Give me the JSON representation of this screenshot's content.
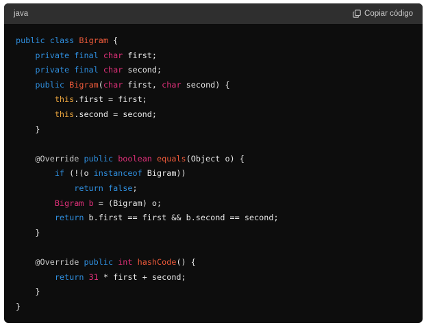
{
  "header": {
    "language": "java",
    "copy_label": "Copiar código",
    "copy_icon": "copy-icon"
  },
  "colors": {
    "background": "#0d0d0d",
    "header_background": "#2f2f2f",
    "keyword": "#2f8fdf",
    "type": "#df3079",
    "name": "#ee5a3a",
    "this": "#e8a33d",
    "plain": "#e8e8e8"
  },
  "code": {
    "lines": [
      [
        [
          "kw",
          "public"
        ],
        [
          "pl",
          " "
        ],
        [
          "kw",
          "class"
        ],
        [
          "pl",
          " "
        ],
        [
          "nm",
          "Bigram"
        ],
        [
          "pl",
          " {"
        ]
      ],
      [
        [
          "pl",
          "    "
        ],
        [
          "kw",
          "private"
        ],
        [
          "pl",
          " "
        ],
        [
          "kw",
          "final"
        ],
        [
          "pl",
          " "
        ],
        [
          "ty",
          "char"
        ],
        [
          "pl",
          " first;"
        ]
      ],
      [
        [
          "pl",
          "    "
        ],
        [
          "kw",
          "private"
        ],
        [
          "pl",
          " "
        ],
        [
          "kw",
          "final"
        ],
        [
          "pl",
          " "
        ],
        [
          "ty",
          "char"
        ],
        [
          "pl",
          " second;"
        ]
      ],
      [
        [
          "pl",
          "    "
        ],
        [
          "kw",
          "public"
        ],
        [
          "pl",
          " "
        ],
        [
          "nm",
          "Bigram"
        ],
        [
          "pl",
          "("
        ],
        [
          "ty",
          "char"
        ],
        [
          "pl",
          " first, "
        ],
        [
          "ty",
          "char"
        ],
        [
          "pl",
          " second) {"
        ]
      ],
      [
        [
          "pl",
          "        "
        ],
        [
          "th",
          "this"
        ],
        [
          "pl",
          ".first = first;"
        ]
      ],
      [
        [
          "pl",
          "        "
        ],
        [
          "th",
          "this"
        ],
        [
          "pl",
          ".second = second;"
        ]
      ],
      [
        [
          "pl",
          "    }"
        ]
      ],
      [
        [
          "pl",
          ""
        ]
      ],
      [
        [
          "pl",
          "    "
        ],
        [
          "an",
          "@Override"
        ],
        [
          "pl",
          " "
        ],
        [
          "kw",
          "public"
        ],
        [
          "pl",
          " "
        ],
        [
          "ty",
          "boolean"
        ],
        [
          "pl",
          " "
        ],
        [
          "nm",
          "equals"
        ],
        [
          "pl",
          "(Object o) {"
        ]
      ],
      [
        [
          "pl",
          "        "
        ],
        [
          "kw",
          "if"
        ],
        [
          "pl",
          " (!(o "
        ],
        [
          "kw",
          "instanceof"
        ],
        [
          "pl",
          " Bigram))"
        ]
      ],
      [
        [
          "pl",
          "            "
        ],
        [
          "kw",
          "return"
        ],
        [
          "pl",
          " "
        ],
        [
          "kw",
          "false"
        ],
        [
          "pl",
          ";"
        ]
      ],
      [
        [
          "pl",
          "        "
        ],
        [
          "ty",
          "Bigram"
        ],
        [
          "pl",
          " "
        ],
        [
          "ty",
          "b"
        ],
        [
          "pl",
          " = (Bigram) o;"
        ]
      ],
      [
        [
          "pl",
          "        "
        ],
        [
          "kw",
          "return"
        ],
        [
          "pl",
          " b.first == first && b.second == second;"
        ]
      ],
      [
        [
          "pl",
          "    }"
        ]
      ],
      [
        [
          "pl",
          ""
        ]
      ],
      [
        [
          "pl",
          "    "
        ],
        [
          "an",
          "@Override"
        ],
        [
          "pl",
          " "
        ],
        [
          "kw",
          "public"
        ],
        [
          "pl",
          " "
        ],
        [
          "ty",
          "int"
        ],
        [
          "pl",
          " "
        ],
        [
          "nm",
          "hashCode"
        ],
        [
          "pl",
          "() {"
        ]
      ],
      [
        [
          "pl",
          "        "
        ],
        [
          "kw",
          "return"
        ],
        [
          "pl",
          " "
        ],
        [
          "nu",
          "31"
        ],
        [
          "pl",
          " * first + second;"
        ]
      ],
      [
        [
          "pl",
          "    }"
        ]
      ],
      [
        [
          "pl",
          "}"
        ]
      ]
    ]
  }
}
